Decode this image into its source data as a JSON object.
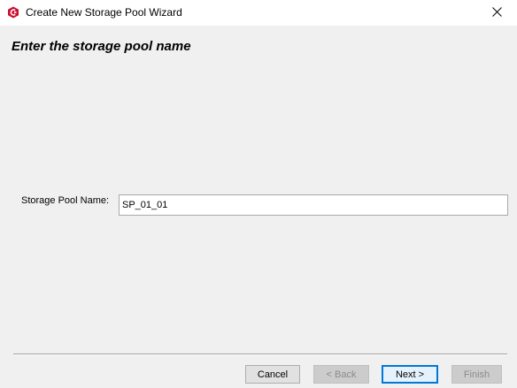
{
  "window": {
    "title": "Create New Storage Pool Wizard",
    "app_icon": "storage-app-icon",
    "close_icon": "close-icon",
    "accent_color": "#c8102e"
  },
  "page": {
    "heading": "Enter the storage pool name"
  },
  "form": {
    "pool_name_label": "Storage Pool Name:",
    "pool_name_value": "SP_01_01"
  },
  "buttons": {
    "cancel": "Cancel",
    "back": "< Back",
    "next": "Next >",
    "finish": "Finish"
  },
  "button_state": {
    "back_enabled": false,
    "next_default": true,
    "finish_enabled": false
  }
}
